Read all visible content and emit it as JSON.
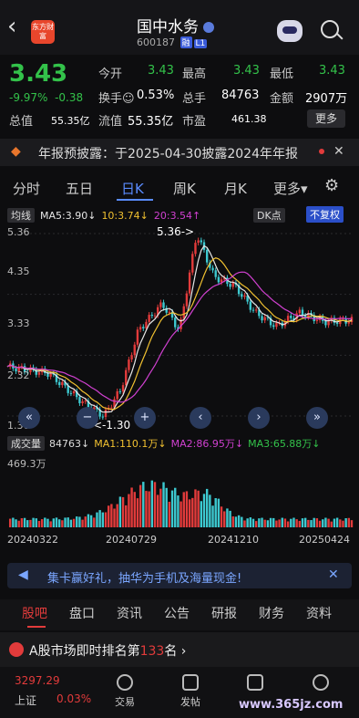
{
  "header": {
    "back": "‹",
    "logo_text": "东方财富",
    "name": "国中水务",
    "code": "600187",
    "badge1": "融",
    "badge2": "L1"
  },
  "quote": {
    "price": "3.43",
    "change_pct": "-9.97%",
    "change": "-0.38",
    "open_label": "今开",
    "open": "3.43",
    "high_label": "最高",
    "high": "3.43",
    "low_label": "最低",
    "low": "3.43",
    "turnover_label": "换手",
    "turnover": "0.53%",
    "volume_label": "总手",
    "volume": "84763",
    "amount_label": "金额",
    "amount": "2907万",
    "mktcap_label": "总值",
    "mktcap": "55.35亿",
    "float_label": "流值",
    "float": "55.35亿",
    "pe_label": "市盈",
    "pe": "461.38",
    "more": "更多"
  },
  "notice": {
    "text": "年报预披露：于2025-04-30披露2024年年报",
    "close": "✕"
  },
  "tabs": [
    "分时",
    "五日",
    "日K",
    "周K",
    "月K",
    "更多▾"
  ],
  "chart": {
    "indicator_btn": "均线",
    "ma5": "MA5:3.90↓",
    "ma10": "10:3.74↓",
    "ma20": "20:3.54↑",
    "dk": "DK点",
    "adjust": "不复权",
    "y_labels": [
      "5.36",
      "4.35",
      "3.33",
      "2.32",
      "1.30"
    ],
    "max_marker": "5.36->",
    "min_marker": "<-1.30",
    "vol_label": "成交量",
    "vol_value": "84763↓",
    "vma1": "MA1:110.1万↓",
    "vma2": "MA2:86.95万↓",
    "vma3": "MA3:65.88万↓",
    "vol_max": "469.3万",
    "dates": [
      "20240322",
      "20240729",
      "20241210",
      "20250424"
    ]
  },
  "chart_data": {
    "type": "line",
    "title": "",
    "x": [
      "20240322",
      "20240729",
      "20241210",
      "20250424"
    ],
    "ylim": [
      1.3,
      5.36
    ],
    "series": [
      {
        "name": "",
        "values": [
          2.4,
          1.3,
          5.36,
          3.43
        ]
      }
    ]
  },
  "banner": {
    "text": "集卡赢好礼，抽华为手机及海量现金!",
    "close": "✕"
  },
  "bottom_tabs": [
    "股吧",
    "盘口",
    "资讯",
    "公告",
    "研报",
    "财务",
    "资料"
  ],
  "rank": {
    "text": "A股市场即时排名第",
    "num": "133",
    "suffix": "名"
  },
  "bottom_nav": {
    "index_value": "3297.29",
    "index_pct": "0.03%",
    "index_name": "上证",
    "items": [
      "交易",
      "发帖",
      "",
      ""
    ]
  },
  "watermark": "www.365jz.com",
  "colors": {
    "down": "#33c24a",
    "accent": "#5a8cff",
    "up": "#e23b3b"
  }
}
